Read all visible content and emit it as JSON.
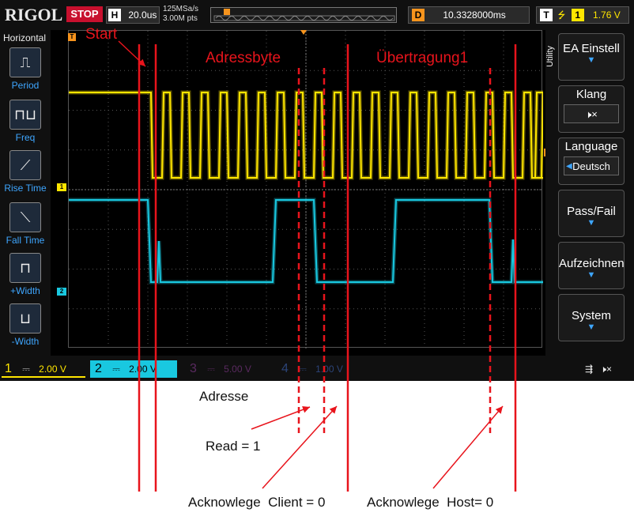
{
  "topbar": {
    "logo": "RIGOL",
    "run_state": "STOP",
    "timebase_letter": "H",
    "timebase": "20.0us",
    "sample_rate": "125MSa/s",
    "memory_depth": "3.00M pts",
    "delay_letter": "D",
    "delay": "10.3328000ms",
    "trigger_letter": "T",
    "trigger_channel": "1",
    "trigger_level": "1.76 V"
  },
  "left_panel": {
    "title": "Horizontal",
    "items": [
      {
        "label": "Period",
        "icon": "period-icon"
      },
      {
        "label": "Freq",
        "icon": "freq-icon"
      },
      {
        "label": "Rise Time",
        "icon": "rise-time-icon"
      },
      {
        "label": "Fall Time",
        "icon": "fall-time-icon"
      },
      {
        "label": "+Width",
        "icon": "positive-width-icon"
      },
      {
        "label": "-Width",
        "icon": "negative-width-icon"
      }
    ]
  },
  "right_menu": {
    "utility_label": "Utility",
    "buttons": [
      {
        "label": "EA Einstell",
        "sub": ""
      },
      {
        "label": "Klang",
        "sub": "mute-icon"
      },
      {
        "label": "Language",
        "sub": "Deutsch"
      },
      {
        "label": "Pass/Fail",
        "sub": ""
      },
      {
        "label": "Aufzeichnen",
        "sub": ""
      },
      {
        "label": "System",
        "sub": ""
      }
    ]
  },
  "channels": [
    {
      "num": "1",
      "scale": "2.00 V",
      "color": "#ffe600",
      "active": true
    },
    {
      "num": "2",
      "scale": "2.00 V",
      "color": "#19c8e0",
      "active": true
    },
    {
      "num": "3",
      "scale": "5.00 V",
      "color": "#c03fd0",
      "active": false
    },
    {
      "num": "4",
      "scale": "1.00 V",
      "color": "#3a6fd8",
      "active": false
    }
  ],
  "markers": {
    "trigger_mark": "T",
    "ch1_mark": "1",
    "ch2_mark": "2"
  },
  "annotations": {
    "start": "Start",
    "adressbyte": "Adressbyte",
    "uebertragung": "Übertragung1",
    "adresse": "Adresse",
    "read": "Read = 1",
    "ack_client": "Acknowlege  Client = 0",
    "ack_host": "Acknowlege  Host= 0"
  },
  "colors": {
    "annotation_red": "#e8141c",
    "ch1_trace": "#ffe600",
    "ch2_trace": "#19c8e0",
    "accent_blue": "#3ea6ff"
  }
}
